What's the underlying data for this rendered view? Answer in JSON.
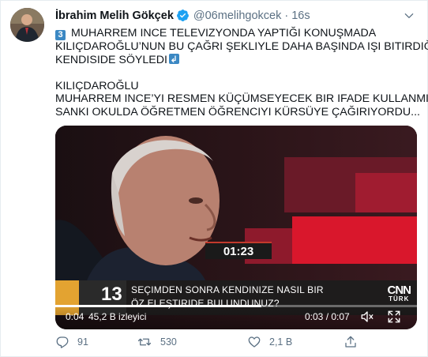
{
  "tweet": {
    "author_name": "İbrahim Melih Gökçek",
    "handle": "@06melihgokcek",
    "separator": "·",
    "time": "16s",
    "text": {
      "number_emoji": "3",
      "line1": "MUHARREM INCE TELEVIZYONDA YAPTIĞI KONUŞMADA",
      "line2": "KILIÇDAROĞLU’NUN BU ÇAĞRI ŞEKLIYLE DAHA BAŞINDA IŞI BITIRDIĞINI",
      "line3": "KENDISIDE SÖYLEDI",
      "line4": "KILIÇDAROĞLU",
      "line5": "MUHARREM INCE’YI RESMEN KÜÇÜMSEYECEK BIR IFADE KULLANMIŞTI.",
      "line6": "SANKI OKULDA ÖĞRETMEN ÖĞRENCIYI KÜRSÜYE ÇAĞIRIYORDU..."
    }
  },
  "video": {
    "timer": "01:23",
    "banner_number": "13",
    "banner_q1": "SEÇIMDEN SONRA KENDINIZE NASIL BIR",
    "banner_q2": "ÖZ ELEŞTIRIDE BULUNDUNUZ?",
    "logo_main": "CNN",
    "logo_sub": "TÜRK",
    "elapsed": "0:04",
    "views": "45,2 B izleyici",
    "position": "0:03 / 0:07",
    "progress": 0.57
  },
  "actions": {
    "reply_count": "91",
    "retweet_count": "530",
    "like_count": "2,1 B"
  },
  "colors": {
    "verified": "#1da1f2",
    "emoji_box": "#3b88c3",
    "muted": "#5b7083"
  }
}
